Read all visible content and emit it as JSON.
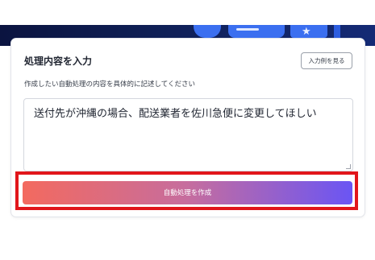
{
  "card": {
    "title": "処理内容を入力",
    "example_button": "入力例を見る",
    "description": "作成したい自動処理の内容を具体的に記述してください",
    "textarea_value": "送付先が沖縄の場合、配送業者を佐川急便に変更してほしい"
  },
  "actions": {
    "create_label": "自動処理を作成"
  },
  "colors": {
    "header_band": "#0f1f55",
    "highlight_border": "#e1161b",
    "button_gradient_start": "#f36a5f",
    "button_gradient_end": "#6a55f4"
  },
  "icons": [
    "chat-bubble-icon",
    "document-icon",
    "star-icon"
  ]
}
